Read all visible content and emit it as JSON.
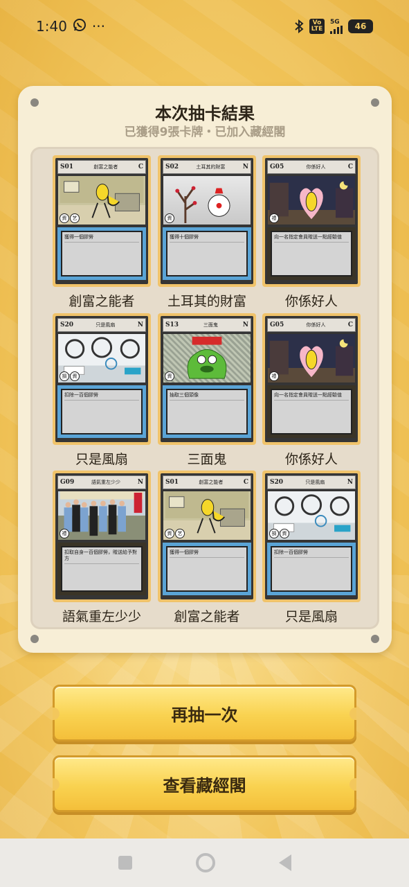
{
  "status_bar": {
    "time": "1:40",
    "whatsapp_icon": "whatsapp-icon",
    "more_dots": "···",
    "volte": "Vo LTE",
    "network": "5G",
    "battery": "46"
  },
  "panel": {
    "title": "本次抽卡結果",
    "subtitle": "已獲得9張卡牌・已加入藏經閣"
  },
  "cards": [
    {
      "code": "S01",
      "name": "創富之能者",
      "rarity": "C",
      "label": "創富之能者",
      "text": "獲得一個膠勞",
      "art": "room",
      "badges": [
        "資",
        "艺"
      ],
      "frame": "blue"
    },
    {
      "code": "S02",
      "name": "土耳其的財富",
      "rarity": "N",
      "label": "土耳其的財富",
      "text": "獲得十個膠勞",
      "art": "pink",
      "badges": [
        "資"
      ],
      "frame": "blue"
    },
    {
      "code": "G05",
      "name": "你係好人",
      "rarity": "C",
      "label": "你係好人",
      "text": "向一名指定會員贈送一點經驗值",
      "art": "night",
      "badges": [
        "禮"
      ],
      "frame": "dark"
    },
    {
      "code": "S20",
      "name": "只是風扇",
      "rarity": "N",
      "label": "只是風扇",
      "text": "扣除一百個膠勞",
      "art": "fans",
      "badges": [
        "損",
        "資"
      ],
      "frame": "blue"
    },
    {
      "code": "S13",
      "name": "三面鬼",
      "rarity": "N",
      "label": "三面鬼",
      "text": "抽取三個頭像",
      "art": "glitter",
      "badges": [
        "資"
      ],
      "frame": "blue"
    },
    {
      "code": "G05",
      "name": "你係好人",
      "rarity": "C",
      "label": "你係好人",
      "text": "向一名指定會員贈送一點經驗值",
      "art": "night",
      "badges": [
        "禮"
      ],
      "frame": "dark"
    },
    {
      "code": "G09",
      "name": "語氣重左少少",
      "rarity": "N",
      "label": "語氣重左少少",
      "text": "扣取自身一百個膠勞，贈送給予對方",
      "art": "crowd",
      "badges": [
        "禮"
      ],
      "frame": "dark"
    },
    {
      "code": "S01",
      "name": "創富之能者",
      "rarity": "C",
      "label": "創富之能者",
      "text": "獲得一個膠勞",
      "art": "room",
      "badges": [
        "資",
        "艺"
      ],
      "frame": "blue"
    },
    {
      "code": "S20",
      "name": "只是風扇",
      "rarity": "N",
      "label": "只是風扇",
      "text": "扣除一百個膠勞",
      "art": "fans",
      "badges": [
        "損",
        "資"
      ],
      "frame": "blue"
    }
  ],
  "buttons": {
    "draw_again": "再抽一次",
    "view_collection": "查看藏經閣"
  },
  "colors": {
    "accent": "#f9d250",
    "panel_bg": "#f7eed6",
    "title": "#2c2418",
    "subtitle": "#a99d87"
  }
}
